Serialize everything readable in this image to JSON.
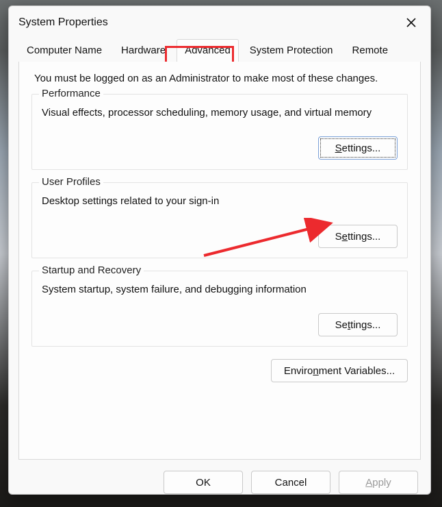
{
  "window": {
    "title": "System Properties"
  },
  "tabs": {
    "computer_name": "Computer Name",
    "hardware": "Hardware",
    "advanced": "Advanced",
    "system_protection": "System Protection",
    "remote": "Remote"
  },
  "intro": "You must be logged on as an Administrator to make most of these changes.",
  "groups": {
    "performance": {
      "title": "Performance",
      "desc": "Visual effects, processor scheduling, memory usage, and virtual memory",
      "button_pre": "",
      "button_u": "S",
      "button_post": "ettings..."
    },
    "user_profiles": {
      "title": "User Profiles",
      "desc": "Desktop settings related to your sign-in",
      "button_pre": "S",
      "button_u": "e",
      "button_post": "ttings..."
    },
    "startup": {
      "title": "Startup and Recovery",
      "desc": "System startup, system failure, and debugging information",
      "button_pre": "Se",
      "button_u": "t",
      "button_post": "tings..."
    }
  },
  "env_button": {
    "pre": "Enviro",
    "u": "n",
    "post": "ment Variables..."
  },
  "buttons": {
    "ok": "OK",
    "cancel": "Cancel",
    "apply_pre": "",
    "apply_u": "A",
    "apply_post": "pply"
  },
  "annotation": {
    "highlight_color": "#ec2a2e"
  }
}
